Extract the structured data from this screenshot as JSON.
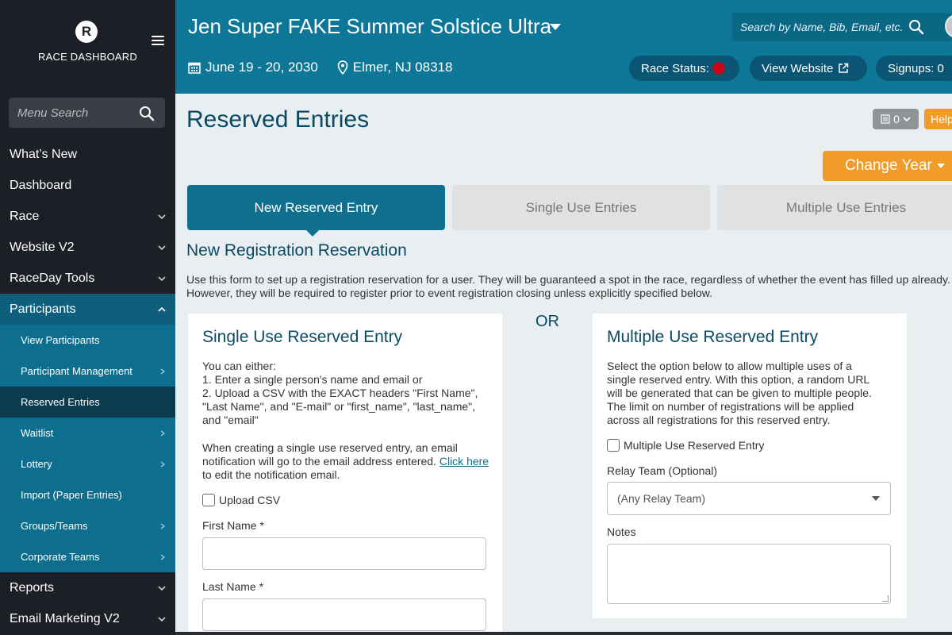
{
  "sidebar": {
    "brand_logo": "R",
    "brand_text": "RACE DASHBOARD",
    "search_placeholder": "Menu Search",
    "nav": [
      {
        "label": "What’s New"
      },
      {
        "label": "Dashboard"
      },
      {
        "label": "Race"
      },
      {
        "label": "Website V2"
      },
      {
        "label": "RaceDay Tools"
      },
      {
        "label": "Participants"
      }
    ],
    "sub": [
      {
        "label": "View Participants"
      },
      {
        "label": "Participant Management"
      },
      {
        "label": "Reserved Entries"
      },
      {
        "label": "Waitlist"
      },
      {
        "label": "Lottery"
      },
      {
        "label": "Import (Paper Entries)"
      },
      {
        "label": "Groups/Teams"
      },
      {
        "label": "Corporate Teams"
      }
    ],
    "after": [
      {
        "label": "Reports"
      },
      {
        "label": "Email Marketing V2"
      }
    ]
  },
  "header": {
    "race_title": "Jen Super FAKE Summer Solstice Ultra",
    "search_placeholder": "Search by Name, Bib, Email, etc.",
    "dates": "June 19 - 20, 2030",
    "location": "Elmer, NJ 08318",
    "race_status_label": "Race Status:",
    "view_website_label": "View Website",
    "signups_label": "Signups: 0"
  },
  "main": {
    "page_title": "Reserved Entries",
    "counter_value": "0",
    "help_label": "Help",
    "change_year_label": "Change Year",
    "tabs": [
      {
        "label": "New Reserved Entry"
      },
      {
        "label": "Single Use Entries"
      },
      {
        "label": "Multiple Use Entries"
      }
    ],
    "section_title": "New Registration Reservation",
    "intro": "Use this form to set up a registration reservation for a user. They will be guaranteed a spot in the race, regardless of whether the event has filled up already. However, they will be required to register prior to event registration closing unless explicitly specified below.",
    "or_label": "OR",
    "single": {
      "title": "Single Use Reserved Entry",
      "para1_line1": "You can either:",
      "para1_line2": "1. Enter a single person's name and email or",
      "para1_line3": "2. Upload a CSV with the EXACT headers \"First Name\", \"Last Name\", and \"E-mail\" or \"first_name\", \"last_name\", and \"email\"",
      "para2": "When creating a single use reserved entry, an email notification will go to the email address entered.",
      "link_text": "Click here",
      "para2_tail": "to edit the notification email.",
      "upload_csv_label": "Upload CSV",
      "first_name_label": "First Name *",
      "last_name_label": "Last Name *"
    },
    "multiple": {
      "title": "Multiple Use Reserved Entry",
      "description": "Select the option below to allow multiple uses of a single reserved entry. With this option, a random URL will be generated that can be given to multiple people. The limit on number of registrations will be applied across all registrations for this reserved entry.",
      "checkbox_label": "Multiple Use Reserved Entry",
      "relay_label": "Relay Team (Optional)",
      "relay_value": "(Any Relay Team)",
      "notes_label": "Notes"
    }
  },
  "colors": {
    "header_teal": "#0e7798",
    "accent_orange": "#f39b28",
    "sidebar_dark": "#1d1f26",
    "status_red": "#d0021b"
  }
}
